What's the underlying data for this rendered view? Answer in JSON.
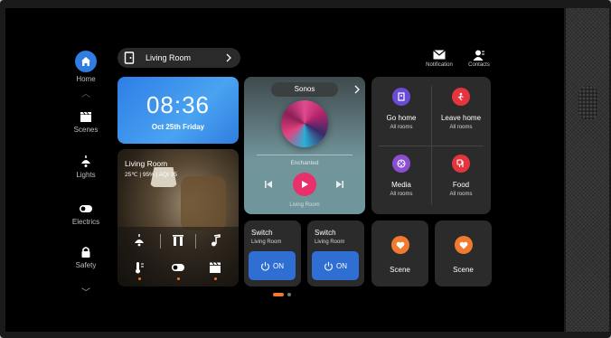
{
  "sidebar": {
    "items": [
      {
        "label": "Home",
        "icon": "home-icon"
      },
      {
        "label": "Scenes",
        "icon": "clapperboard-icon"
      },
      {
        "label": "Lights",
        "icon": "lamp-icon"
      },
      {
        "label": "Electrics",
        "icon": "toggle-icon"
      },
      {
        "label": "Safety",
        "icon": "lock-icon"
      }
    ]
  },
  "room_selector": {
    "label": "Living Room"
  },
  "header": {
    "notification": "Notification",
    "contacts": "Contacts"
  },
  "clock": {
    "time": "08:36",
    "date": "Oct 25th Friday"
  },
  "room_card": {
    "title": "Living Room",
    "stats": "25℃  |  95%  |  AQI 25"
  },
  "music": {
    "source": "Sonos",
    "track": "Enchanted",
    "room": "Living Room"
  },
  "scenes": [
    {
      "label": "Go home",
      "sub": "All rooms",
      "color": "#6b4bd6"
    },
    {
      "label": "Leave home",
      "sub": "All rooms",
      "color": "#e2353e"
    },
    {
      "label": "Media",
      "sub": "All rooms",
      "color": "#8a4fd1"
    },
    {
      "label": "Food",
      "sub": "All rooms",
      "color": "#e2353e"
    }
  ],
  "switches": [
    {
      "title": "Switch",
      "room": "Living Room",
      "state": "ON"
    },
    {
      "title": "Switch",
      "room": "Living Room",
      "state": "ON"
    }
  ],
  "scene_tiles": [
    {
      "label": "Scene"
    },
    {
      "label": "Scene"
    }
  ],
  "colors": {
    "accent_blue": "#2f7de0",
    "play_pink": "#e8306a",
    "scene_orange": "#f07a2e"
  }
}
